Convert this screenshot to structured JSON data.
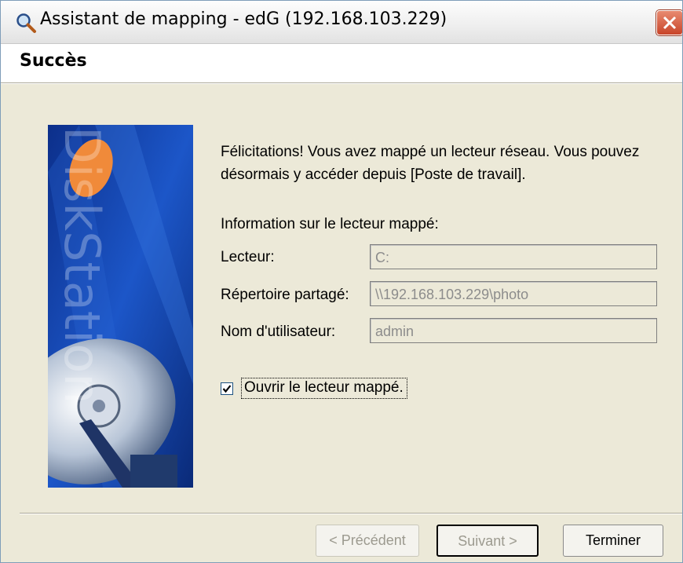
{
  "window": {
    "title": "Assistant de mapping - edG (192.168.103.229)",
    "title_icon": "magnifier-icon",
    "close_icon": "close-icon"
  },
  "header": {
    "title": "Succès"
  },
  "banner": {
    "brand_text": "DiskStation",
    "image": "hard-disk-illustration"
  },
  "body": {
    "message": "Félicitations! Vous avez mappé un lecteur réseau.  Vous pouvez désormais y accéder depuis [Poste de travail].",
    "info_heading": "Information sur le lecteur mappé:",
    "fields": [
      {
        "label": "Lecteur:",
        "value": "C:"
      },
      {
        "label": "Répertoire partagé:",
        "value": "\\\\192.168.103.229\\photo"
      },
      {
        "label": "Nom d'utilisateur:",
        "value": "admin"
      }
    ],
    "checkbox": {
      "label": "Ouvrir le lecteur mappé.",
      "checked": true
    }
  },
  "buttons": {
    "previous": "< Précédent",
    "next": "Suivant >",
    "finish": "Terminer"
  },
  "colors": {
    "close_button": "#d6512e",
    "banner_blue": "#1a4fb8",
    "accent_orange": "#f08a3a"
  }
}
